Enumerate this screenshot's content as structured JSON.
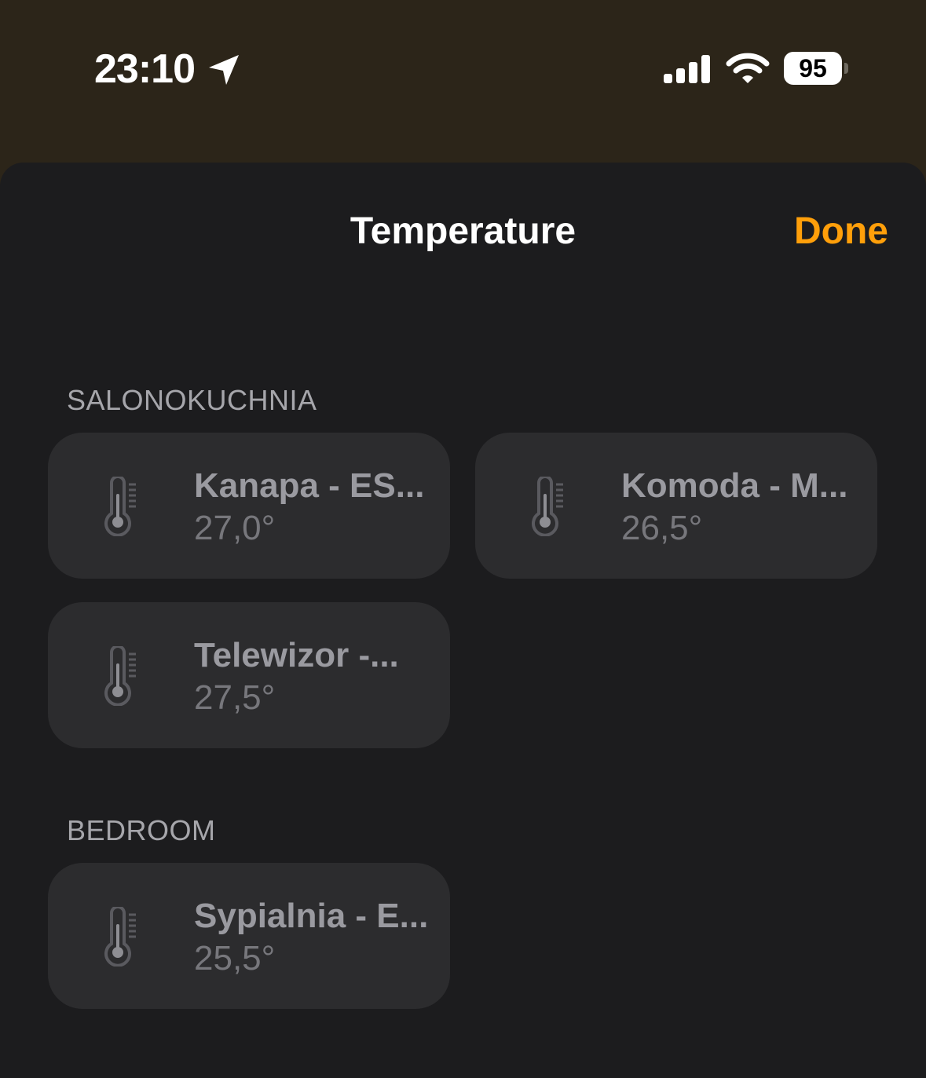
{
  "status_bar": {
    "time": "23:10",
    "battery_level": "95",
    "icons": [
      "location-arrow-icon",
      "cellular-signal-icon",
      "wifi-icon",
      "battery-icon"
    ]
  },
  "header": {
    "title": "Temperature",
    "done_label": "Done"
  },
  "sections": [
    {
      "title": "SALONOKUCHNIA",
      "tiles": [
        {
          "name": "Kanapa - ES...",
          "value": "27,0°",
          "icon": "thermometer-icon"
        },
        {
          "name": "Komoda - M...",
          "value": "26,5°",
          "icon": "thermometer-icon"
        },
        {
          "name": "Telewizor -...",
          "value": "27,5°",
          "icon": "thermometer-icon"
        }
      ]
    },
    {
      "title": "BEDROOM",
      "tiles": [
        {
          "name": "Sypialnia - E...",
          "value": "25,5°",
          "icon": "thermometer-icon"
        }
      ]
    }
  ],
  "colors": {
    "accent": "#ff9f0a",
    "sheet_background": "#1c1c1e",
    "tile_background": "#2c2c2e",
    "status_background": "#2c2519"
  }
}
